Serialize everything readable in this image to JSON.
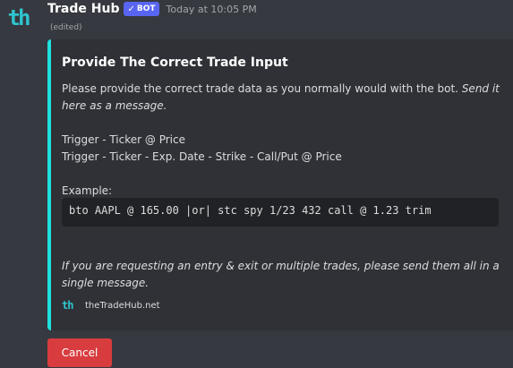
{
  "message": {
    "avatar_text": "th",
    "username": "Trade Hub",
    "bot_tag": "BOT",
    "bot_check": "✓",
    "timestamp": "Today at 10:05 PM",
    "edited": "(edited)"
  },
  "embed": {
    "accent_color": "#1ee0dc",
    "title": "Provide The Correct Trade Input",
    "intro_plain": "Please provide the correct trade data as you normally would with the bot. ",
    "intro_italic": "Send it here as a message.",
    "format_line_1": "Trigger - Ticker @ Price",
    "format_line_2": "Trigger - Ticker - Exp. Date - Strike - Call/Put @ Price",
    "example_label": "Example:",
    "example_code": "bto AAPL @ 165.00 |or| stc spy 1/23 432 call @ 1.23 trim",
    "note": "If you are requesting an entry & exit or multiple trades, please send them all in a single message.",
    "footer_icon": "th",
    "footer_text": "theTradeHub.net"
  },
  "actions": {
    "cancel_label": "Cancel",
    "cancel_color": "#d83c3e"
  }
}
